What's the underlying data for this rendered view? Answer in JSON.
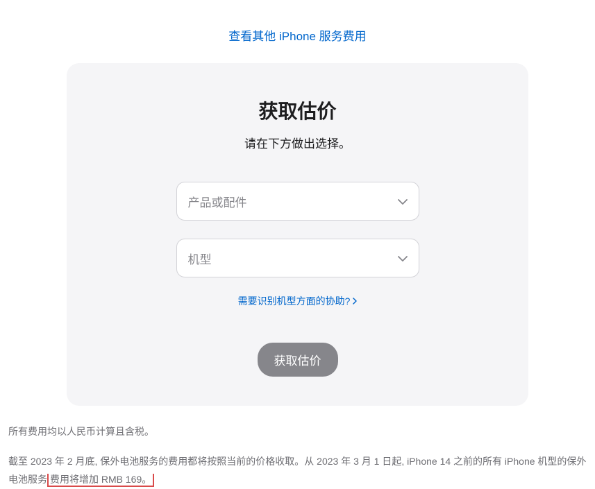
{
  "topLink": "查看其他 iPhone 服务费用",
  "card": {
    "title": "获取估价",
    "subtitle": "请在下方做出选择。",
    "select1Placeholder": "产品或配件",
    "select2Placeholder": "机型",
    "helpLink": "需要识别机型方面的协助?",
    "submitLabel": "获取估价"
  },
  "footer": {
    "line1": "所有费用均以人民币计算且含税。",
    "line2_part1": "截至 2023 年 2 月底, 保外电池服务的费用都将按照当前的价格收取。从 2023 年 3 月 1 日起, iPhone 14 之前的所有 iPhone 机型的保外电池服务",
    "line2_highlight": "费用将增加 RMB 169。"
  }
}
